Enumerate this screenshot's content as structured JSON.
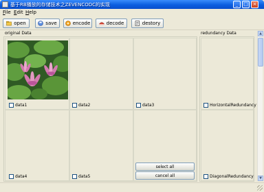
{
  "window": {
    "title": "基于RB播放的存储技术之ZEVENCODC的实现"
  },
  "menu": {
    "items": [
      {
        "label": "File",
        "mnemonic": "F",
        "rest": "ile"
      },
      {
        "label": "Edit",
        "mnemonic": "E",
        "rest": "dit"
      },
      {
        "label": "Help",
        "mnemonic": "H",
        "rest": "elp"
      }
    ]
  },
  "toolbar": {
    "open": "open",
    "save": "save",
    "encode": "encode",
    "decode": "decode",
    "destory": "destory"
  },
  "groups": {
    "original": "original Data",
    "redundancy": "redundancy Data"
  },
  "cells": {
    "data1": "data1",
    "data2": "data2",
    "data3": "data3",
    "data4": "data4",
    "data5": "data5"
  },
  "redundancy": {
    "horizontal": "HorizontalRedundancy",
    "diagonal": "DiagonalRedundancy"
  },
  "actions": {
    "select_all": "select all",
    "cancel_all": "cancel all"
  },
  "colors": {
    "titlebar": "#0b5ee0",
    "window_bg": "#ece9d8",
    "button_border": "#7f9db9"
  }
}
